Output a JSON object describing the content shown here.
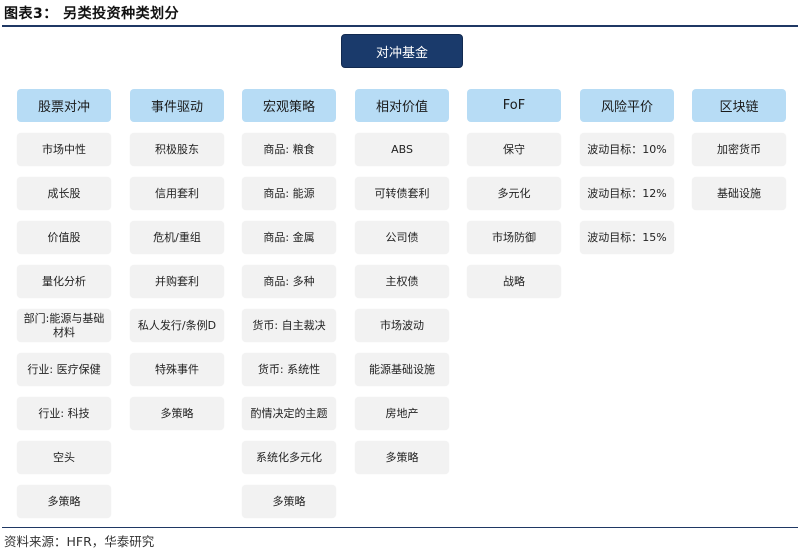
{
  "figure": {
    "title": "图表3：  另类投资种类划分",
    "source": "资料来源：HFR，华泰研究"
  },
  "root": {
    "label": "对冲基金"
  },
  "categories": [
    {
      "label": "股票对冲",
      "items": [
        "市场中性",
        "成长股",
        "价值股",
        "量化分析",
        "部门:能源与基础材料",
        "行业: 医疗保健",
        "行业: 科技",
        "空头",
        "多策略"
      ]
    },
    {
      "label": "事件驱动",
      "items": [
        "积极股东",
        "信用套利",
        "危机/重组",
        "并购套利",
        "私人发行/条例D",
        "特殊事件",
        "多策略"
      ]
    },
    {
      "label": "宏观策略",
      "items": [
        "商品: 粮食",
        "商品: 能源",
        "商品: 金属",
        "商品: 多种",
        "货币: 自主裁决",
        "货币: 系统性",
        "酌情决定的主题",
        "系统化多元化",
        "多策略"
      ]
    },
    {
      "label": "相对价值",
      "items": [
        "ABS",
        "可转债套利",
        "公司债",
        "主权债",
        "市场波动",
        "能源基础设施",
        "房地产",
        "多策略"
      ]
    },
    {
      "label": "FoF",
      "items": [
        "保守",
        "多元化",
        "市场防御",
        "战略"
      ]
    },
    {
      "label": "风险平价",
      "items": [
        "波动目标：10%",
        "波动目标：12%",
        "波动目标：15%"
      ]
    },
    {
      "label": "区块链",
      "items": [
        "加密货币",
        "基础设施"
      ]
    }
  ]
}
